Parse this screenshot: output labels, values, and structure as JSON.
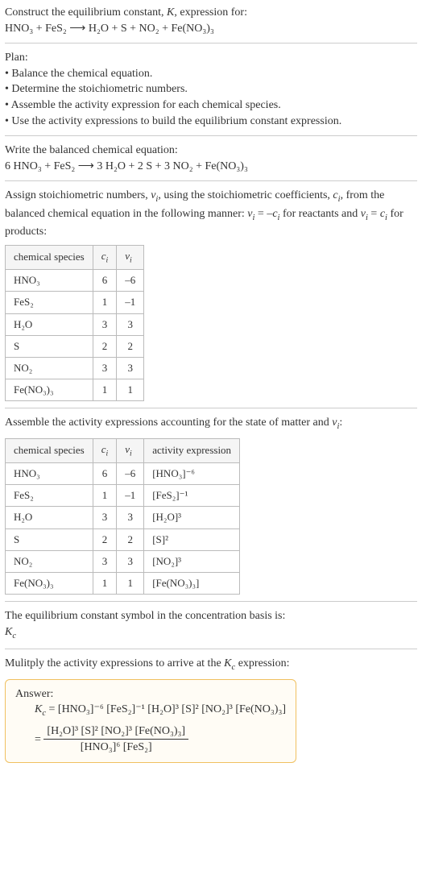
{
  "title": {
    "line1": "Construct the equilibrium constant, K, expression for:",
    "line2": "HNO₃ + FeS₂ ⟶ H₂O + S + NO₂ + Fe(NO₃)₃"
  },
  "plan": {
    "heading": "Plan:",
    "items": [
      "• Balance the chemical equation.",
      "• Determine the stoichiometric numbers.",
      "• Assemble the activity expression for each chemical species.",
      "• Use the activity expressions to build the equilibrium constant expression."
    ]
  },
  "balanced": {
    "heading": "Write the balanced chemical equation:",
    "eq": "6 HNO₃ + FeS₂ ⟶ 3 H₂O + 2 S + 3 NO₂ + Fe(NO₃)₃"
  },
  "assign": {
    "text": "Assign stoichiometric numbers, νᵢ, using the stoichiometric coefficients, cᵢ, from the balanced chemical equation in the following manner: νᵢ = –cᵢ for reactants and νᵢ = cᵢ for products:"
  },
  "table1": {
    "headers": [
      "chemical species",
      "cᵢ",
      "νᵢ"
    ],
    "rows": [
      {
        "species": "HNO₃",
        "c": "6",
        "v": "–6"
      },
      {
        "species": "FeS₂",
        "c": "1",
        "v": "–1"
      },
      {
        "species": "H₂O",
        "c": "3",
        "v": "3"
      },
      {
        "species": "S",
        "c": "2",
        "v": "2"
      },
      {
        "species": "NO₂",
        "c": "3",
        "v": "3"
      },
      {
        "species": "Fe(NO₃)₃",
        "c": "1",
        "v": "1"
      }
    ]
  },
  "assemble": {
    "text": "Assemble the activity expressions accounting for the state of matter and νᵢ:"
  },
  "table2": {
    "headers": [
      "chemical species",
      "cᵢ",
      "νᵢ",
      "activity expression"
    ],
    "rows": [
      {
        "species": "HNO₃",
        "c": "6",
        "v": "–6",
        "expr": "[HNO₃]⁻⁶"
      },
      {
        "species": "FeS₂",
        "c": "1",
        "v": "–1",
        "expr": "[FeS₂]⁻¹"
      },
      {
        "species": "H₂O",
        "c": "3",
        "v": "3",
        "expr": "[H₂O]³"
      },
      {
        "species": "S",
        "c": "2",
        "v": "2",
        "expr": "[S]²"
      },
      {
        "species": "NO₂",
        "c": "3",
        "v": "3",
        "expr": "[NO₂]³"
      },
      {
        "species": "Fe(NO₃)₃",
        "c": "1",
        "v": "1",
        "expr": "[Fe(NO₃)₃]"
      }
    ]
  },
  "symbol": {
    "line1": "The equilibrium constant symbol in the concentration basis is:",
    "line2": "K_c"
  },
  "mult": {
    "text": "Mulitply the activity expressions to arrive at the K_c expression:"
  },
  "answer": {
    "label": "Answer:",
    "line1": "K_c = [HNO₃]⁻⁶ [FeS₂]⁻¹ [H₂O]³ [S]² [NO₂]³ [Fe(NO₃)₃]",
    "line2_prefix": "= ",
    "frac_num": "[H₂O]³ [S]² [NO₂]³ [Fe(NO₃)₃]",
    "frac_den": "[HNO₃]⁶ [FeS₂]"
  }
}
